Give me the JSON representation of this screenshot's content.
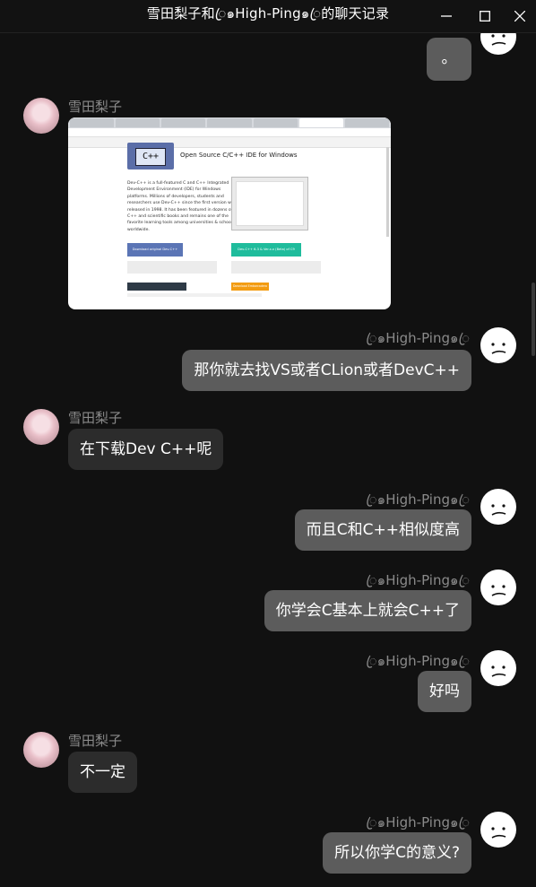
{
  "window": {
    "title": "雪田梨子和ꦿ๑High-Ping๑ꦿ的聊天记录",
    "buttons": [
      "minimize",
      "maximize",
      "close"
    ]
  },
  "participants": {
    "other": "雪田梨子",
    "me": "ꦿ๑High-Ping๑ꦿ"
  },
  "messages": [
    {
      "sender": "me",
      "text": "。"
    },
    {
      "sender": "other",
      "type": "image",
      "image": {
        "heading": "Open Source C/C++ IDE for Windows",
        "description": "Dev-C++ is a full-featured C and C++ Integrated Development Environment (IDE) for Windows platforms. Millions of developers, students and researchers use Dev-C++ since the first version was released in 1998. It has been featured in dozens of C++ and scientific books and remains one of the favorite learning tools among universities & schools worldwide.",
        "download_left": "Download original Dev-C++",
        "download_right": "Dev-C++ 6.3 & Ver.x.x (Beta) of C9",
        "footer_button": "Download Embarcadero"
      }
    },
    {
      "sender": "me",
      "text": "那你就去找VS或者CLion或者DevC++"
    },
    {
      "sender": "other",
      "text": "在下载Dev C++呢"
    },
    {
      "sender": "me",
      "text": "而且C和C++相似度高"
    },
    {
      "sender": "me",
      "text": "你学会C基本上就会C++了"
    },
    {
      "sender": "me",
      "text": "好吗"
    },
    {
      "sender": "other",
      "text": "不一定"
    },
    {
      "sender": "me",
      "text": "所以你学C的意义?"
    }
  ],
  "colors": {
    "background": "#111111",
    "bubble_me": "#5c5c5c",
    "bubble_other": "#2c2c2c",
    "nickname": "#8a8a8a"
  }
}
